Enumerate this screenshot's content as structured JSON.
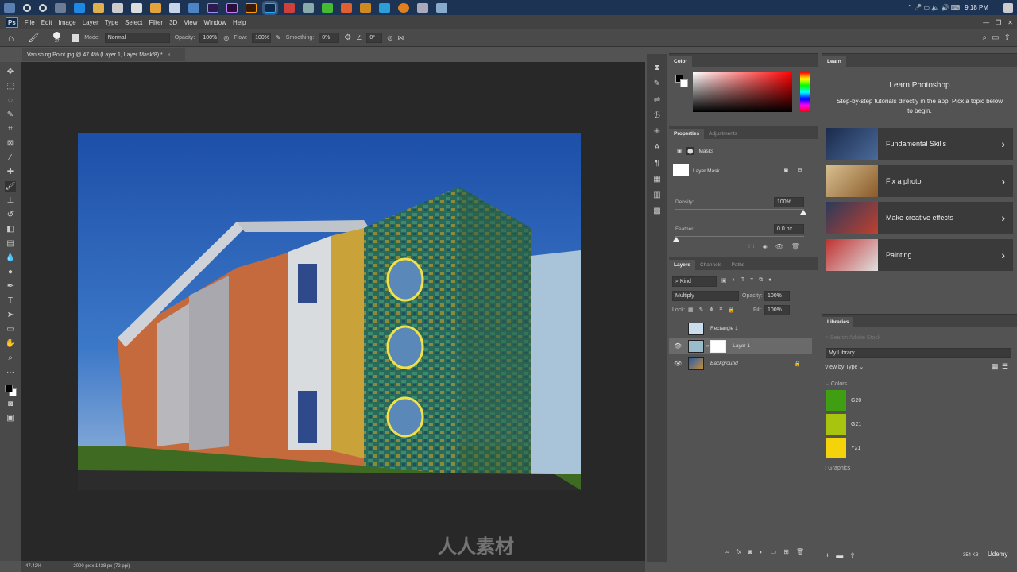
{
  "taskbar": {
    "clock": "9:18 PM"
  },
  "menu": {
    "logo": "Ps",
    "items": [
      "File",
      "Edit",
      "Image",
      "Layer",
      "Type",
      "Select",
      "Filter",
      "3D",
      "View",
      "Window",
      "Help"
    ]
  },
  "options": {
    "brush_size": "37",
    "mode_label": "Mode:",
    "mode": "Normal",
    "opacity_label": "Opacity:",
    "opacity": "100%",
    "flow_label": "Flow:",
    "flow": "100%",
    "smoothing_label": "Smoothing:",
    "smoothing": "0%",
    "angle": "0°"
  },
  "document": {
    "tab": "Vanishing Point.jpg @ 47.4% (Layer 1, Layer Mask/8) *",
    "zoom": "47.42%",
    "size": "2000 px x 1428 px (72 ppi)"
  },
  "color_panel": {
    "title": "Color"
  },
  "properties": {
    "tabs": [
      "Properties",
      "Adjustments"
    ],
    "masks_label": "Masks",
    "layer_mask": "Layer Mask",
    "density_label": "Density:",
    "density": "100%",
    "density_value": 1.0,
    "feather_label": "Feather:",
    "feather": "0.0 px",
    "feather_value": 0.0
  },
  "layers": {
    "tabs": [
      "Layers",
      "Channels",
      "Paths"
    ],
    "kind": "Kind",
    "blend": "Multiply",
    "opacity_label": "Opacity:",
    "opacity": "100%",
    "lock_label": "Lock:",
    "fill_label": "Fill:",
    "fill": "100%",
    "items": [
      {
        "name": "Rectangle 1",
        "visible": false
      },
      {
        "name": "Layer 1",
        "visible": true,
        "selected": true
      },
      {
        "name": "Background",
        "visible": true,
        "locked": true
      }
    ]
  },
  "learn": {
    "tab": "Learn",
    "title": "Learn Photoshop",
    "subtitle": "Step-by-step tutorials directly in the app. Pick a topic below to begin.",
    "topics": [
      "Fundamental Skills",
      "Fix a photo",
      "Make creative effects",
      "Painting"
    ]
  },
  "libraries": {
    "tab": "Libraries",
    "search_placeholder": "Search Adobe Stock",
    "library": "My Library",
    "view": "View by Type",
    "colors_label": "Colors",
    "colors": [
      {
        "name": "G20",
        "hex": "#3f9e12"
      },
      {
        "name": "G21",
        "hex": "#a9c40e"
      },
      {
        "name": "Y21",
        "hex": "#f5d30b"
      }
    ],
    "graphics_label": "Graphics",
    "storage": "354 KB"
  },
  "watermark": {
    "brand": "人人素材",
    "udemy": "Udemy"
  }
}
